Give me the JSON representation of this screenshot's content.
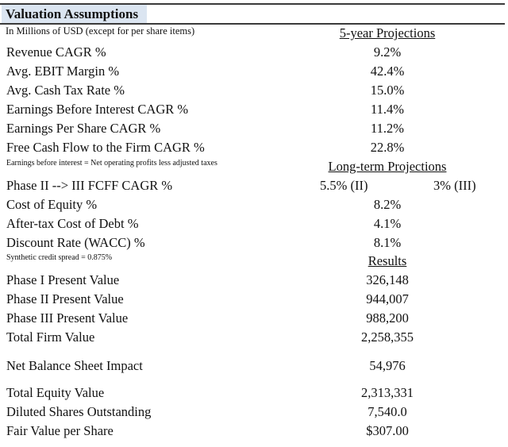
{
  "title": "Valuation Assumptions",
  "subtitle": "In Millions of USD (except for per share items)",
  "sections": {
    "five_year": {
      "header": "5-year Projections",
      "rows": [
        {
          "label": "Revenue CAGR %",
          "value": "9.2%"
        },
        {
          "label": "Avg. EBIT Margin %",
          "value": "42.4%"
        },
        {
          "label": "Avg. Cash Tax Rate %",
          "value": "15.0%"
        },
        {
          "label": "Earnings Before Interest CAGR %",
          "value": "11.4%"
        },
        {
          "label": "Earnings Per Share CAGR %",
          "value": "11.2%"
        },
        {
          "label": "Free Cash Flow to the Firm CAGR %",
          "value": "22.8%"
        }
      ],
      "note": "Earnings before interest = Net operating profits less adjusted taxes"
    },
    "long_term": {
      "header": "Long-term Projections",
      "phase_row": {
        "label": "Phase II --> III FCFF CAGR %",
        "value_phase2": "5.5% (II)",
        "value_phase3": "3% (III)"
      },
      "rows": [
        {
          "label": "Cost of Equity %",
          "value": "8.2%"
        },
        {
          "label": "After-tax Cost of Debt %",
          "value": "4.1%"
        },
        {
          "label": "Discount Rate (WACC) %",
          "value": "8.1%"
        }
      ],
      "note": "Synthetic credit spread = 0.875%"
    },
    "results": {
      "header": "Results",
      "rows": [
        {
          "label": "Phase I Present Value",
          "value": "326,148"
        },
        {
          "label": "Phase II Present Value",
          "value": "944,007"
        },
        {
          "label": "Phase III Present Value",
          "value": "988,200"
        },
        {
          "label": "Total Firm Value",
          "value": "2,258,355"
        },
        {
          "label": "Net Balance Sheet Impact",
          "value": "54,976"
        },
        {
          "label": "Total Equity Value",
          "value": "2,313,331"
        },
        {
          "label": "Diluted Shares Outstanding",
          "value": "7,540.0"
        },
        {
          "label": "Fair Value per Share",
          "value": "$307.00"
        }
      ]
    }
  }
}
